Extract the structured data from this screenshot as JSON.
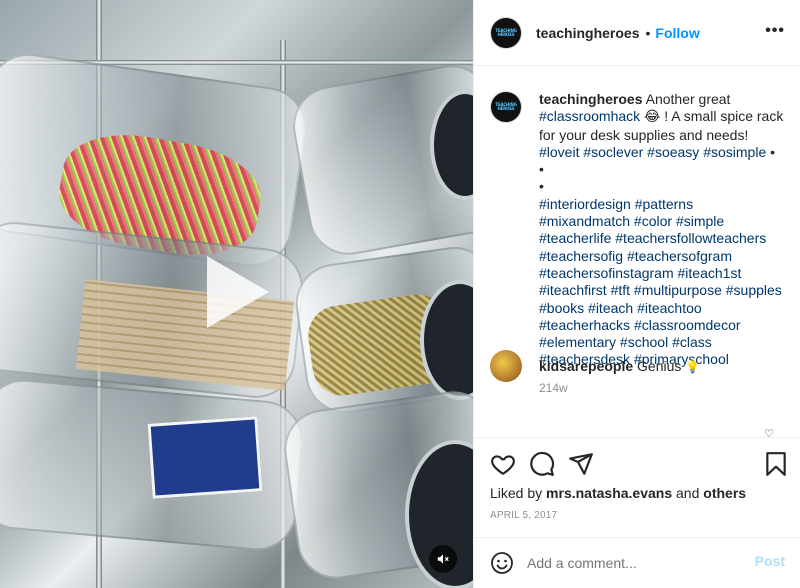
{
  "header": {
    "username": "teachingheroes",
    "separator": "•",
    "follow_label": "Follow",
    "more_label": "•••",
    "avatar_text": "TEACHING HEROES"
  },
  "caption": {
    "username": "teachingheroes",
    "intro": "Another great",
    "hashtag_first": "#classroomhack",
    "emoji": "😂",
    "text1": "! A small spice rack for your desk supplies and needs!",
    "tags_line1": "#loveit #soclever #soeasy #sosimple",
    "bullet": "•",
    "hashtags_block": "#interiordesign #patterns #mixandmatch #color #simple #teacherlife #teachersfollowteachers #teachersofig #teachersofgram #teachersofinstagram #iteach1st #iteachfirst #tft #multipurpose #supples #books #iteach #iteachtoo #teacherhacks #classroomdecor #elementary #school #class #teachersdesk #primaryschool",
    "age": "214w"
  },
  "comment": {
    "username": "kidsarepeople",
    "text": "Genius",
    "emoji": "💡",
    "like_icon": "♡"
  },
  "actions": {
    "liked_by_prefix": "Liked by",
    "liked_by_user": "mrs.natasha.evans",
    "liked_by_and": "and",
    "liked_by_others": "others",
    "date": "APRIL 5, 2017"
  },
  "comment_input": {
    "placeholder": "Add a comment...",
    "post_label": "Post"
  },
  "media": {
    "mute_icon": "🔇"
  },
  "colors": {
    "link_blue": "#0095f6",
    "hashtag": "#00376b",
    "muted": "#8e8e8e",
    "post_disabled": "#b2dffc"
  }
}
